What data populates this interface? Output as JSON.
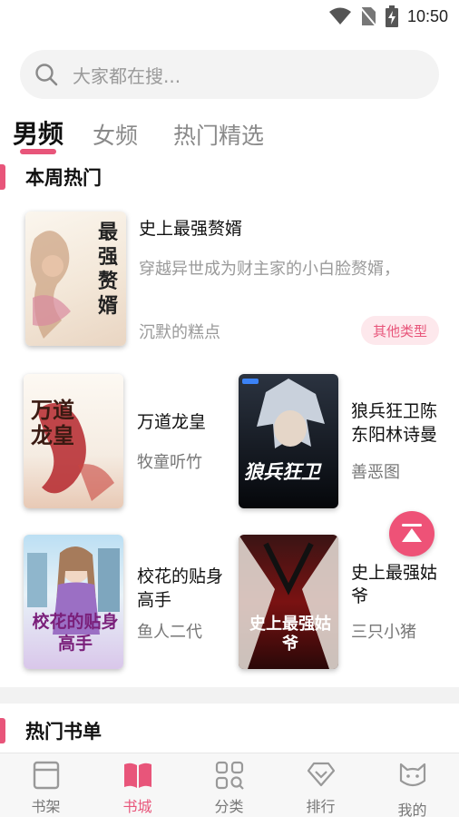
{
  "status_bar": {
    "time": "10:50"
  },
  "search": {
    "placeholder": "大家都在搜..."
  },
  "tabs": [
    {
      "label": "男频",
      "active": true
    },
    {
      "label": "女频",
      "active": false
    },
    {
      "label": "热门精选",
      "active": false
    }
  ],
  "weekly_hot": {
    "title": "本周热门",
    "featured": {
      "title": "史上最强赘婿",
      "description": "穿越异世成为财主家的小白脸赘婿，",
      "author": "沉默的糕点",
      "genre": "其他类型",
      "cover_text": "最强赘婿"
    },
    "books": [
      {
        "title": "万道龙皇",
        "author": "牧童听竹",
        "cover_text": "万道龙皇"
      },
      {
        "title": "狼兵狂卫陈东阳林诗曼",
        "author": "善恶图",
        "cover_text": "狼兵狂卫"
      },
      {
        "title": "校花的贴身高手",
        "author": "鱼人二代",
        "cover_text": "校花的贴身高手"
      },
      {
        "title": "史上最强姑爷",
        "author": "三只小猪",
        "cover_text": "史上最强姑爷"
      }
    ]
  },
  "hot_booklist": {
    "title": "热门书单"
  },
  "bottom_nav": [
    {
      "label": "书架",
      "icon": "bookshelf-icon",
      "active": false
    },
    {
      "label": "书城",
      "icon": "open-book-icon",
      "active": true
    },
    {
      "label": "分类",
      "icon": "category-grid-icon",
      "active": false
    },
    {
      "label": "排行",
      "icon": "ranking-diamond-icon",
      "active": false
    },
    {
      "label": "我的",
      "icon": "cat-face-icon",
      "active": false
    }
  ],
  "colors": {
    "accent": "#e8557a",
    "fab": "#ee5277",
    "search_bg": "#f3f3f3"
  }
}
